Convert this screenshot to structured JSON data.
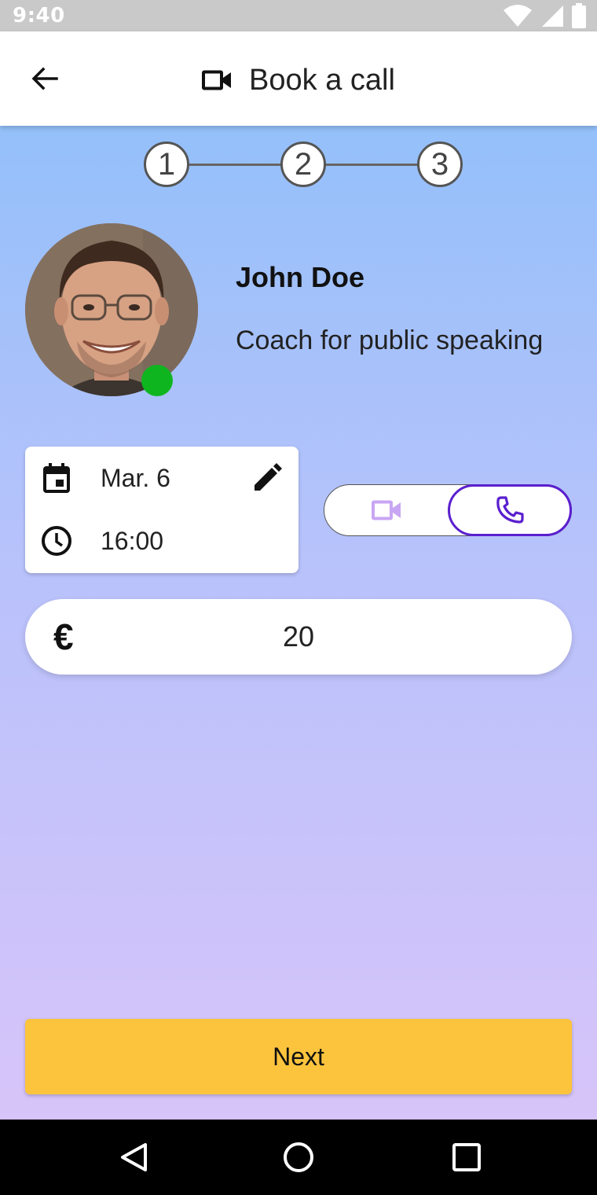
{
  "status_bar": {
    "time": "9:40",
    "icons": [
      "wifi-icon",
      "cell-signal-icon",
      "battery-icon"
    ]
  },
  "app_bar": {
    "back_icon": "arrow-back-icon",
    "title_icon": "videocam-icon",
    "title": "Book a call"
  },
  "stepper": {
    "steps": [
      "1",
      "2",
      "3"
    ]
  },
  "coach": {
    "name": "John Doe",
    "role": "Coach for public speaking",
    "online": true,
    "status_color": "#0fb51f"
  },
  "schedule": {
    "date": "Mar. 6",
    "time": "16:00",
    "date_icon": "calendar-icon",
    "time_icon": "clock-icon",
    "edit_icon": "pencil-icon"
  },
  "call_type": {
    "options": [
      "video",
      "phone"
    ],
    "selected": "phone",
    "accent_color": "#5a1fcf",
    "inactive_color": "#c9a6f3"
  },
  "price": {
    "currency_symbol": "€",
    "amount": "20"
  },
  "actions": {
    "next_label": "Next",
    "next_color": "#fcc43d"
  },
  "nav_bar": {
    "buttons": [
      "back-triangle-icon",
      "home-circle-icon",
      "recents-square-icon"
    ]
  },
  "theme": {
    "gradient_top": "#94c0fa",
    "gradient_bottom": "#d7c4f9"
  }
}
